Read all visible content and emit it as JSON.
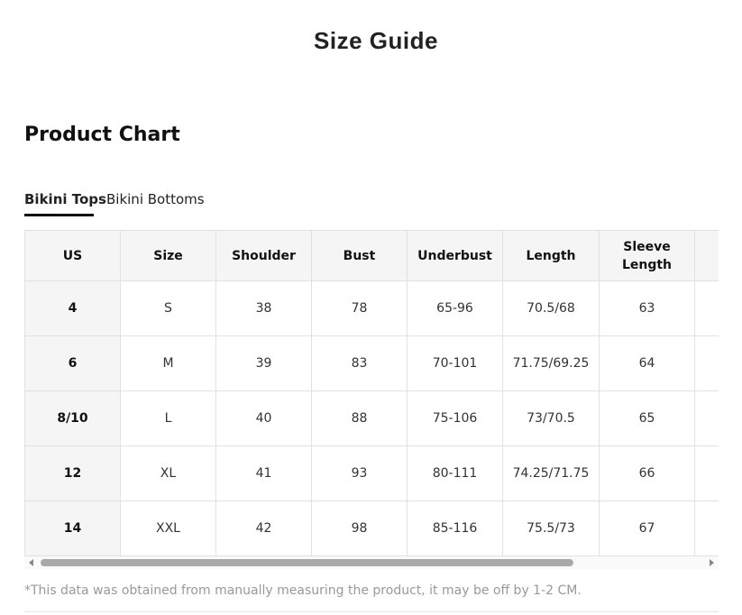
{
  "page": {
    "title": "Size Guide"
  },
  "section": {
    "title": "Product Chart"
  },
  "tabs": [
    {
      "label": "Bikini Tops",
      "active": true
    },
    {
      "label": "Bikini Bottoms",
      "active": false
    }
  ],
  "table": {
    "headers": [
      "US",
      "Size",
      "Shoulder",
      "Bust",
      "Underbust",
      "Length",
      "Sleeve Length",
      ""
    ],
    "rows": [
      [
        "4",
        "S",
        "38",
        "78",
        "65-96",
        "70.5/68",
        "63",
        ""
      ],
      [
        "6",
        "M",
        "39",
        "83",
        "70-101",
        "71.75/69.25",
        "64",
        ""
      ],
      [
        "8/10",
        "L",
        "40",
        "88",
        "75-106",
        "73/70.5",
        "65",
        ""
      ],
      [
        "12",
        "XL",
        "41",
        "93",
        "80-111",
        "74.25/71.75",
        "66",
        ""
      ],
      [
        "14",
        "XXL",
        "42",
        "98",
        "85-116",
        "75.5/73",
        "67",
        ""
      ]
    ]
  },
  "scrollbar": {
    "left_arrow_icon": "chevron-left-icon",
    "right_arrow_icon": "chevron-right-icon"
  },
  "footnote": "*This data was obtained from manually measuring the product, it may be off by 1-2 CM."
}
